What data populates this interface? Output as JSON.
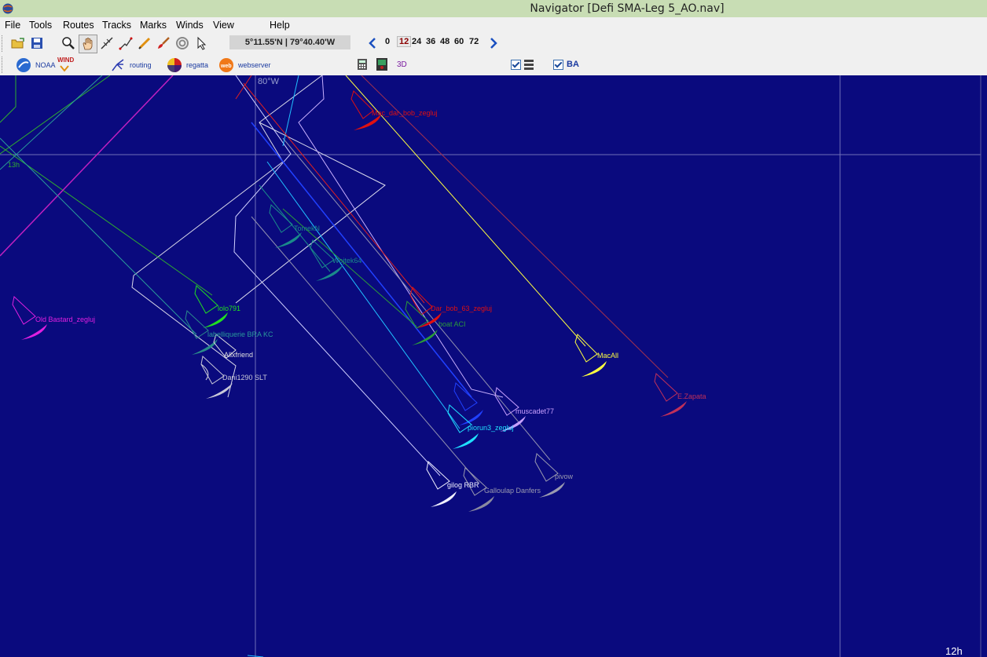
{
  "window": {
    "title": "Navigator [Defi SMA-Leg 5_AO.nav]"
  },
  "menu": [
    "File",
    "Tools",
    "Routes",
    "Tracks",
    "Marks",
    "Winds",
    "View",
    "Help"
  ],
  "toolbar": {
    "coordinates": "5°11.55'N | 79°40.40'W",
    "time_steps": [
      "0",
      "12",
      "24",
      "36",
      "48",
      "60",
      "72"
    ],
    "active_step": "12",
    "noaa_label": "NOAA",
    "wind_label": "WIND",
    "routing_label": "routing",
    "regatta_label": "regatta",
    "webserver_label": "webserver",
    "view3d_label": "3D",
    "ba_label": "BA"
  },
  "map": {
    "meridian_label": "80°W",
    "left_time_label": "13h",
    "bottom_time_label": "12h",
    "boats": [
      {
        "name": "Mac_dar_bob_zegluj",
        "color": "#e01010"
      },
      {
        "name": "TomekN",
        "color": "#1a8a8a"
      },
      {
        "name": "Wojtek64",
        "color": "#1a8a8a"
      },
      {
        "name": "Dar_bob_63_zegluj",
        "color": "#e01010"
      },
      {
        "name": "boat ACI",
        "color": "#2a9a3a"
      },
      {
        "name": "MacAll",
        "color": "#ffff40"
      },
      {
        "name": "E.Zapata",
        "color": "#c0305a"
      },
      {
        "name": "Old Bastard_zegluj",
        "color": "#e020e0"
      },
      {
        "name": "lolo791",
        "color": "#20e020"
      },
      {
        "name": "labelliquerie BRA KC",
        "color": "#2a8a8a"
      },
      {
        "name": "Allxfriend",
        "color": "#e0e0e0"
      },
      {
        "name": "Dani1290 SLT",
        "color": "#c8c8d8"
      },
      {
        "name": "muscadet77",
        "color": "#c8a0ff"
      },
      {
        "name": "piorun3_zegluj",
        "color": "#20e0ff"
      },
      {
        "name": "pivow",
        "color": "#9a9ab0"
      },
      {
        "name": "gilog RBR",
        "color": "#f0f0ff"
      },
      {
        "name": "Galloulap Danfers",
        "color": "#9a9ab0"
      }
    ]
  },
  "colors": {
    "map_background": "#0a0a7e",
    "titlebar": "#c8ddb4",
    "grid_line": "#6a6ab0"
  }
}
